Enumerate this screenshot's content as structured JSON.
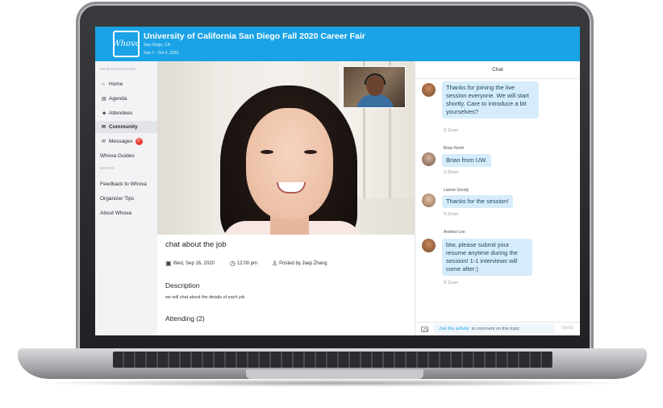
{
  "header": {
    "logo_text": "Whova",
    "event_title": "University of California San Diego Fall 2020 Career Fair",
    "location": "San Diego, CA",
    "dates": "Sep 7 - Oct 4, 2020",
    "color": "#1aa3e6"
  },
  "sidebar": {
    "main_heading": "MAIN NAVIGATION",
    "items": [
      {
        "label": "Home",
        "icon": "home-icon"
      },
      {
        "label": "Agenda",
        "icon": "calendar-icon"
      },
      {
        "label": "Attendees",
        "icon": "people-icon"
      },
      {
        "label": "Community",
        "icon": "chat-bubbles-icon",
        "active": true
      },
      {
        "label": "Messages",
        "icon": "envelope-icon",
        "badge": "37"
      },
      {
        "label": "Whova Guides",
        "icon": ""
      }
    ],
    "whova_heading": "WHOVA",
    "whova_items": [
      {
        "label": "Feedback to Whova"
      },
      {
        "label": "Organizer Tips"
      },
      {
        "label": "About Whova"
      }
    ]
  },
  "session": {
    "title": "chat about the job",
    "date": "Wed, Sep 16, 2020",
    "time": "12:00 pm",
    "posted_by": "Posted by Jiaqi Zhang",
    "description_heading": "Description",
    "description_text": "we will chat about the details of each job",
    "attending": "Attending (2)"
  },
  "chat": {
    "header": "Chat",
    "messages": [
      {
        "name": "",
        "text": "Thanks for joining the live session everyone. We will start shortly. Care to introduce a bit yourselves?",
        "time": "9:11am"
      },
      {
        "name": "Brian North",
        "text": "Brian from UW.",
        "time": "9:30am"
      },
      {
        "name": "Lianne Goody",
        "text": "Thanks for the session!",
        "time": "9:32am"
      },
      {
        "name": "Andrew Lee",
        "text": "btw, please submit your resume anytime during the session! 1-1 interviews will come after:)",
        "time": "9:11am"
      }
    ],
    "join_link": "Join the activity",
    "comment_placeholder": "to comment on this topic",
    "send_label": "Send",
    "bubble_color": "#d6ecfb"
  }
}
